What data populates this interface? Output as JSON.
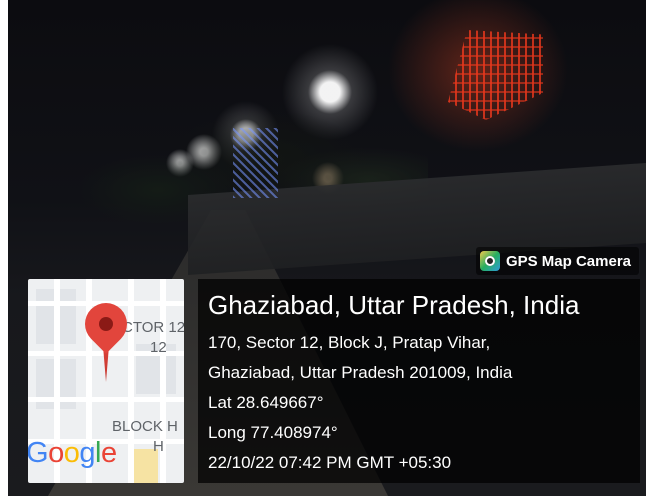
{
  "badge": {
    "icon": "camera-icon",
    "text": "GPS Map Camera"
  },
  "map": {
    "labels": {
      "sector": "CTOR 12",
      "sector_number": "12",
      "block": "BLOCK H",
      "block_letter": "H"
    },
    "logo": [
      "G",
      "o",
      "o",
      "g",
      "l",
      "e"
    ],
    "logo_colors": [
      "#4285F4",
      "#EA4335",
      "#FBBC05",
      "#4285F4",
      "#34A853",
      "#EA4335"
    ],
    "pin_icon": "map-pin-icon",
    "pin_color": "#e2453c"
  },
  "info": {
    "title": "Ghaziabad, Uttar Pradesh, India",
    "address_line1": "170, Sector 12, Block J, Pratap Vihar,",
    "address_line2": "Ghaziabad, Uttar Pradesh 201009, India",
    "latitude": "Lat 28.649667°",
    "longitude": "Long 77.408974°",
    "timestamp": "22/10/22 07:42 PM GMT +05:30"
  }
}
